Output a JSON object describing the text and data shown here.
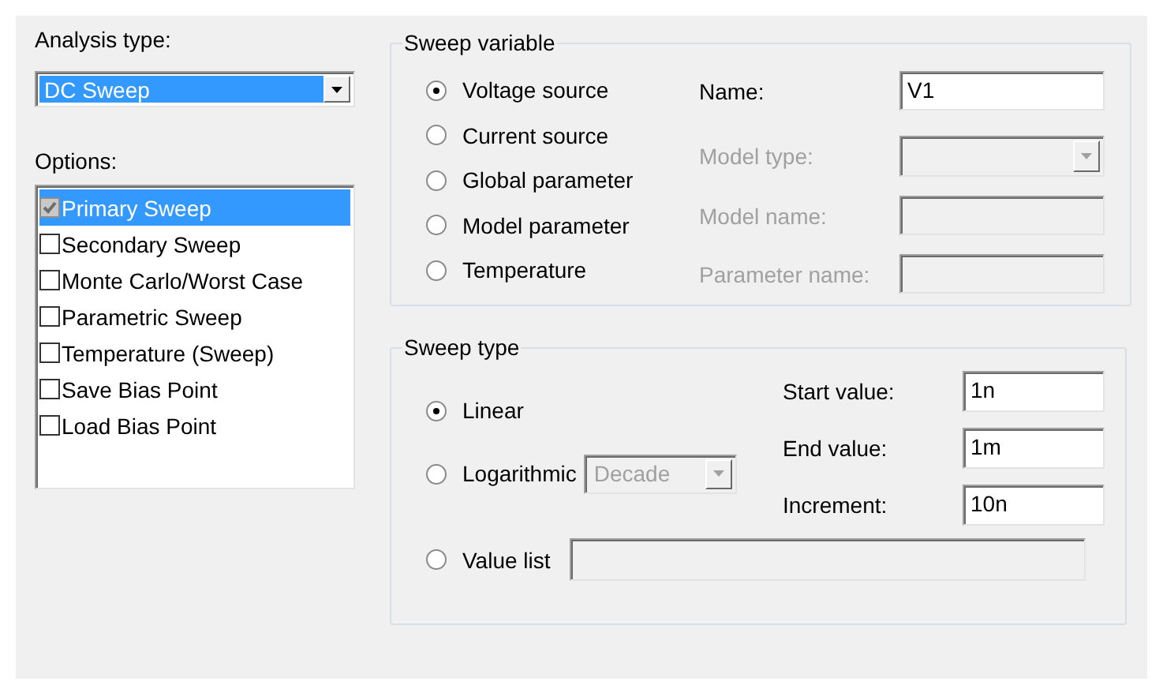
{
  "analysis_type": {
    "label": "Analysis type:",
    "value": "DC Sweep"
  },
  "options": {
    "label": "Options:",
    "items": [
      {
        "label": "Primary Sweep",
        "checked": true,
        "selected": true,
        "disabled": true
      },
      {
        "label": "Secondary Sweep",
        "checked": false,
        "selected": false,
        "disabled": false
      },
      {
        "label": "Monte Carlo/Worst Case",
        "checked": false,
        "selected": false,
        "disabled": false
      },
      {
        "label": "Parametric Sweep",
        "checked": false,
        "selected": false,
        "disabled": false
      },
      {
        "label": "Temperature (Sweep)",
        "checked": false,
        "selected": false,
        "disabled": false
      },
      {
        "label": "Save Bias Point",
        "checked": false,
        "selected": false,
        "disabled": false
      },
      {
        "label": "Load Bias Point",
        "checked": false,
        "selected": false,
        "disabled": false
      }
    ]
  },
  "sweep_variable": {
    "title": "Sweep variable",
    "choices": [
      {
        "label": "Voltage source",
        "selected": true
      },
      {
        "label": "Current source",
        "selected": false
      },
      {
        "label": "Global parameter",
        "selected": false
      },
      {
        "label": "Model parameter",
        "selected": false
      },
      {
        "label": "Temperature",
        "selected": false
      }
    ],
    "fields": [
      {
        "kind": "text",
        "label": "Name:",
        "value": "V1",
        "disabled": false
      },
      {
        "kind": "dropdown",
        "label": "Model type:",
        "disabled": true
      },
      {
        "kind": "text",
        "label": "Model name:",
        "disabled": true
      },
      {
        "kind": "text",
        "label": "Parameter name:",
        "disabled": true
      }
    ]
  },
  "sweep_type": {
    "title": "Sweep type",
    "linear": {
      "label": "Linear",
      "selected": true
    },
    "logarithmic": {
      "label": "Logarithmic",
      "selected": false,
      "scale": {
        "value": "Decade",
        "disabled": true
      }
    },
    "value_list": {
      "label": "Value list",
      "selected": false,
      "disabled": true
    },
    "fields": [
      {
        "label": "Start value:",
        "value": "1n"
      },
      {
        "label": "End value:",
        "value": "1m"
      },
      {
        "label": "Increment:",
        "value": "10n"
      }
    ]
  }
}
